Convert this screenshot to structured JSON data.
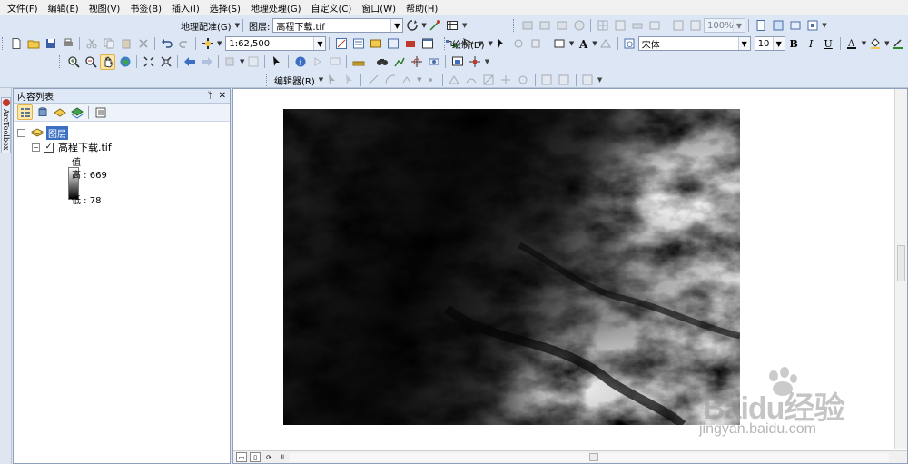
{
  "menu": [
    "文件(F)",
    "编辑(E)",
    "视图(V)",
    "书签(B)",
    "插入(I)",
    "选择(S)",
    "地理处理(G)",
    "自定义(C)",
    "窗口(W)",
    "帮助(H)"
  ],
  "georef": {
    "label": "地理配准(G)",
    "layer_label": "图层:",
    "layer_value": "高程下载.tif"
  },
  "zoom_value": "100%",
  "scale_value": "1:62,500",
  "draw": {
    "label": "绘制(D)",
    "font_name": "宋体",
    "font_size": "10",
    "bold": "B",
    "italic": "I",
    "underline": "U",
    "font_color_glyph": "A"
  },
  "editor_label": "编辑器(R)",
  "toc": {
    "title": "内容列表",
    "pin": "ᛘ",
    "close": "✕",
    "group_name": "图层",
    "layer_name": "高程下载.tif",
    "legend_title": "值",
    "high_label": "高 : 669",
    "low_label": "低 : 78"
  },
  "arctoolbox_label": "ArcToolbox",
  "watermark": {
    "brand": "Baidu经验",
    "url": "jingyan.baidu.com"
  },
  "colors": {
    "accent": "#3a6fc4",
    "toolbar_bg": "#dce6f4",
    "panel_border": "#8fa0ba"
  }
}
